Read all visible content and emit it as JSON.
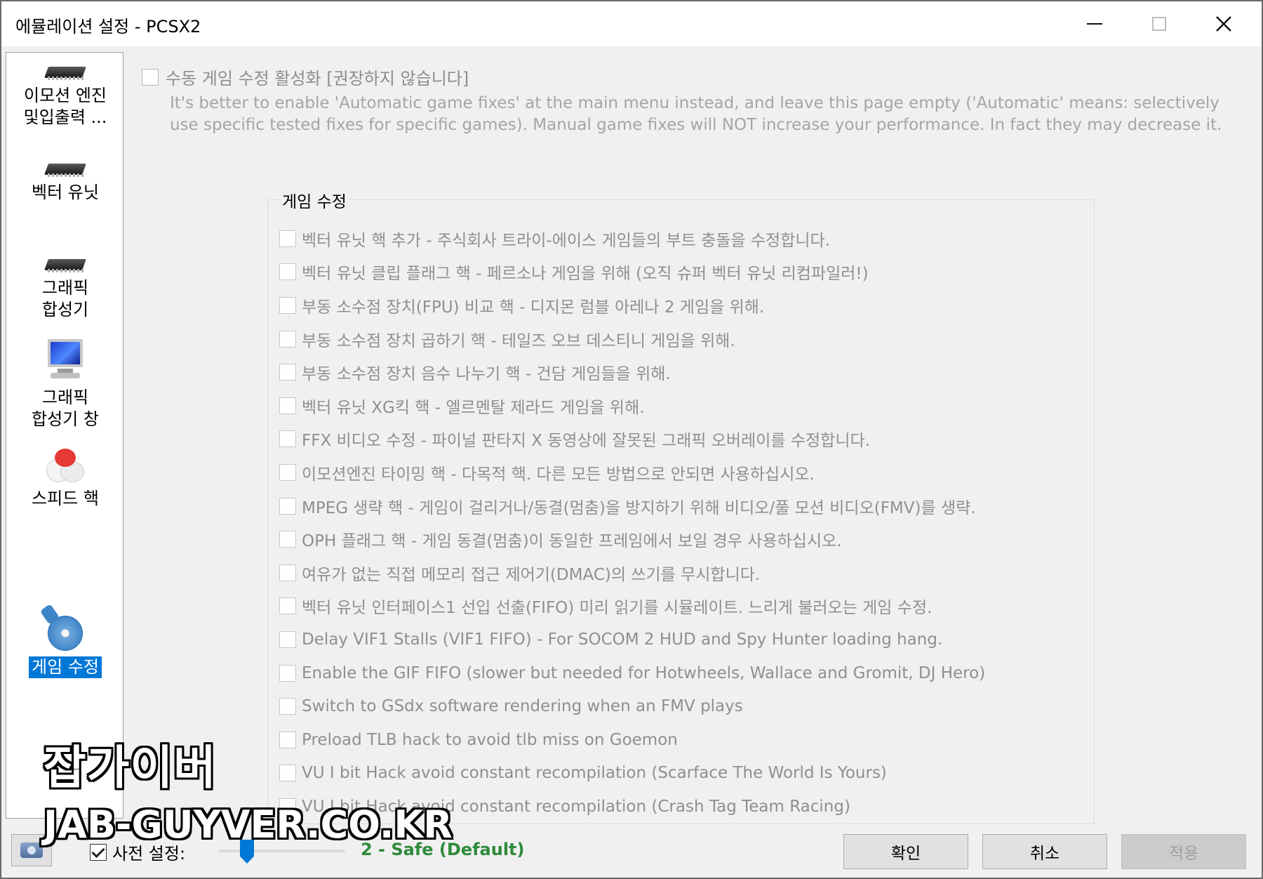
{
  "window": {
    "title": "에뮬레이션 설정 - PCSX2"
  },
  "sidebar": {
    "items": [
      {
        "label": "이모션 엔진\n및입출력 ...",
        "icon": "chip-icon",
        "selected": false
      },
      {
        "label": "벡터 유닛",
        "icon": "chip-icon",
        "selected": false
      },
      {
        "label": "그래픽\n합성기",
        "icon": "chip-icon",
        "selected": false
      },
      {
        "label": "그래픽\n합성기 창",
        "icon": "monitor-icon",
        "selected": false
      },
      {
        "label": "스피드 핵",
        "icon": "speed-icon",
        "selected": false
      },
      {
        "label": "게임 수정",
        "icon": "disc-wrench-icon",
        "selected": true
      }
    ]
  },
  "manual": {
    "label": "수동 게임 수정 활성화 [권장하지 않습니다]",
    "checked": false,
    "description": "It's better to enable 'Automatic game fixes' at the main menu instead, and leave this page empty ('Automatic' means: selectively use specific tested fixes for specific games). Manual game fixes will NOT increase your performance. In fact they may decrease it."
  },
  "gamefixes": {
    "title": "게임 수정",
    "items": [
      {
        "label": "벡터 유닛 핵 추가 - 주식회사 트라이-에이스 게임들의 부트 충돌을 수정합니다.",
        "checked": false
      },
      {
        "label": "벡터 유닛 클립 플래그 핵 - 페르소나 게임을 위해 (오직 슈퍼 벡터 유닛 리컴파일러!)",
        "checked": false
      },
      {
        "label": "부동 소수점 장치(FPU) 비교 핵 - 디지몬 럼블 아레나 2 게임을 위해.",
        "checked": false
      },
      {
        "label": "부동 소수점 장치 곱하기 핵 - 테일즈 오브 데스티니 게임을 위해.",
        "checked": false
      },
      {
        "label": "부동 소수점 장치 음수 나누기 핵 - 건담 게임들을 위해.",
        "checked": false
      },
      {
        "label": "벡터 유닛 XG킥 핵 - 엘르멘탈 제라드 게임을 위해.",
        "checked": false
      },
      {
        "label": "FFX 비디오 수정 - 파이널 판타지 X 동영상에 잘못된 그래픽 오버레이를 수정합니다.",
        "checked": false
      },
      {
        "label": "이모션엔진 타이밍 핵 - 다목적 핵. 다른 모든 방법으로 안되면 사용하십시오.",
        "checked": false
      },
      {
        "label": "MPEG 생략 핵 - 게임이 걸리거나/동결(멈춤)을 방지하기 위해 비디오/풀 모션 비디오(FMV)를 생략.",
        "checked": false
      },
      {
        "label": "OPH 플래그 핵 - 게임 동결(멈춤)이 동일한 프레임에서 보일 경우 사용하십시오.",
        "checked": false
      },
      {
        "label": "여유가 없는 직접 메모리 접근 제어기(DMAC)의 쓰기를 무시합니다.",
        "checked": false
      },
      {
        "label": "벡터 유닛 인터페이스1 선입 선출(FIFO) 미리 읽기를 시뮬레이트. 느리게 불러오는 게임 수정.",
        "checked": false
      },
      {
        "label": "Delay VIF1 Stalls (VIF1 FIFO) - For SOCOM 2 HUD and Spy Hunter loading hang.",
        "checked": false
      },
      {
        "label": "Enable the GIF FIFO (slower but needed for Hotwheels, Wallace and Gromit, DJ Hero)",
        "checked": false
      },
      {
        "label": "Switch to GSdx software rendering when an FMV plays",
        "checked": false
      },
      {
        "label": "Preload TLB hack to avoid tlb miss on Goemon",
        "checked": false
      },
      {
        "label": "VU I bit Hack avoid constant recompilation (Scarface The World Is Yours)",
        "checked": false
      },
      {
        "label": "VU I bit Hack avoid constant recompilation (Crash Tag Team Racing)",
        "checked": false
      }
    ]
  },
  "bottom": {
    "preset_label": "사전 설정:",
    "preset_checked": true,
    "preset_value": "2 - Safe (Default)",
    "ok_label": "확인",
    "cancel_label": "취소",
    "apply_label": "적용"
  },
  "watermark": {
    "line1": "잡가이버",
    "line2": "JAB-GUYVER.CO.KR"
  },
  "colors": {
    "accent": "#0078d7",
    "preset_value": "#2e8b3a"
  }
}
